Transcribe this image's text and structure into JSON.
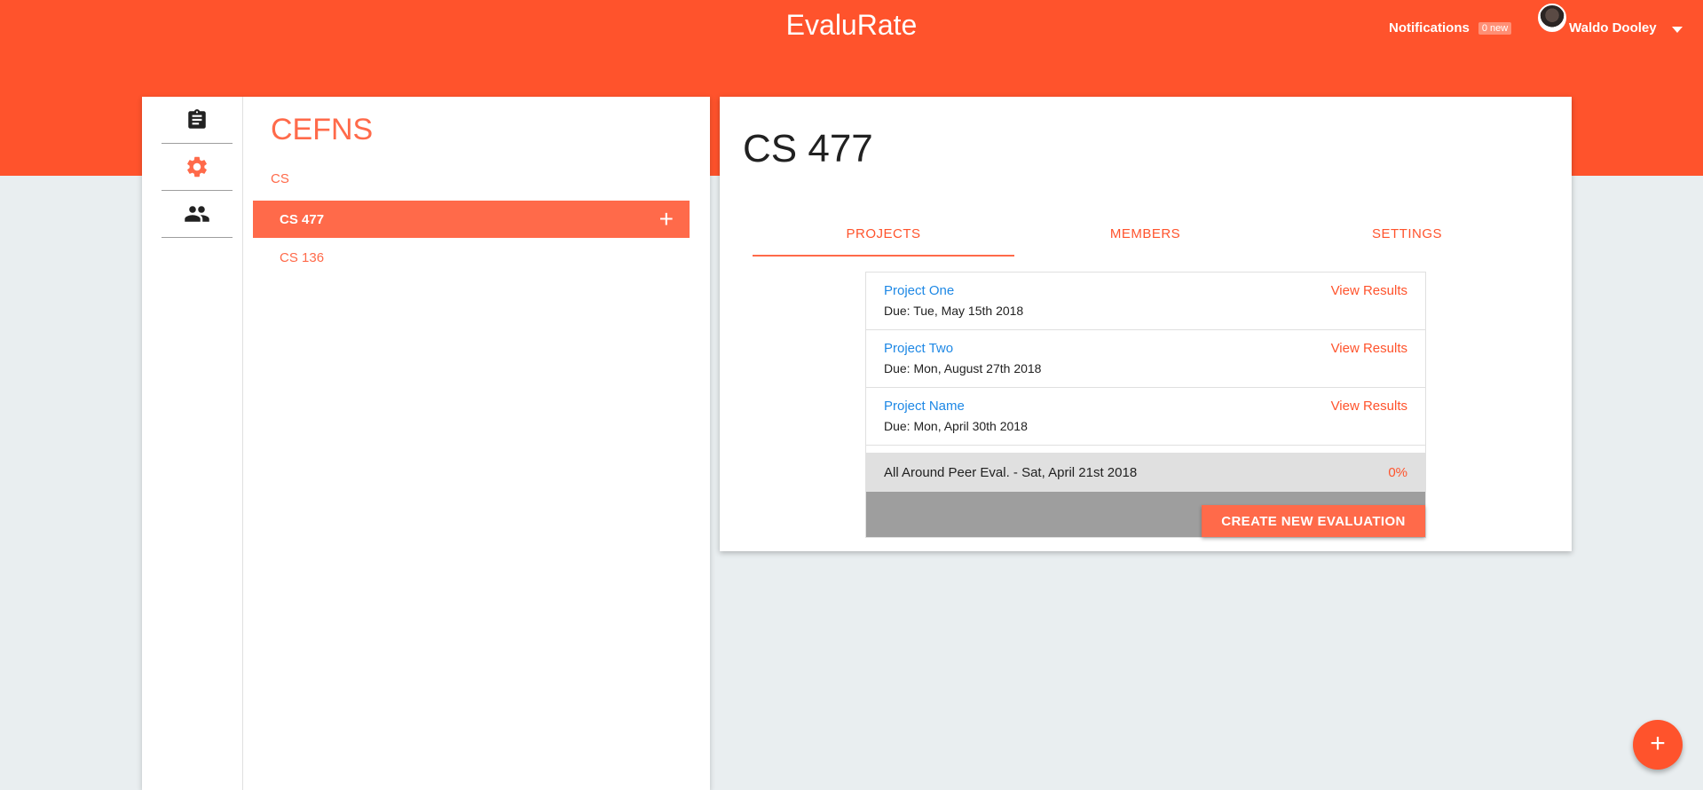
{
  "header": {
    "app_title": "EvaluRate",
    "notifications_label": "Notifications",
    "notifications_badge": "0 new",
    "user_name": "Waldo Dooley"
  },
  "rail": {
    "icons": [
      "clipboard-icon",
      "gear-icon",
      "people-icon"
    ]
  },
  "nav": {
    "school": "CEFNS",
    "department": "CS",
    "courses": [
      {
        "label": "CS 477",
        "active": true
      },
      {
        "label": "CS 136",
        "active": false
      }
    ],
    "add_symbol": "+"
  },
  "main": {
    "course_title": "CS 477",
    "tabs": [
      {
        "label": "PROJECTS",
        "active": true
      },
      {
        "label": "MEMBERS",
        "active": false
      },
      {
        "label": "SETTINGS",
        "active": false
      }
    ],
    "projects": [
      {
        "name": "Project One",
        "due": "Due: Tue, May 15th 2018",
        "action": "View Results"
      },
      {
        "name": "Project Two",
        "due": "Due: Mon, August 27th 2018",
        "action": "View Results"
      },
      {
        "name": "Project Name",
        "due": "Due: Mon, April 30th 2018",
        "action": "View Results"
      }
    ],
    "peer_eval": {
      "label": "All Around Peer Eval. - Sat, April 21st 2018",
      "progress": "0%"
    },
    "create_button": "CREATE NEW EVALUATION"
  },
  "fab_symbol": "+",
  "colors": {
    "accent": "#ff532c",
    "accent_light": "#ff6a4a",
    "link_blue": "#1e88e5"
  }
}
